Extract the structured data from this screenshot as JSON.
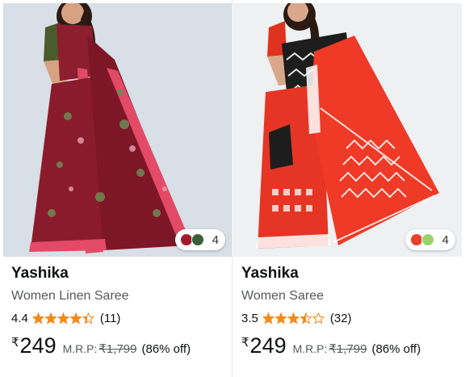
{
  "products": [
    {
      "brand": "Yashika",
      "title": "Women Linen Saree",
      "rating": 4.4,
      "rating_text": "4.4",
      "review_count": "(11)",
      "currency_symbol": "₹",
      "price": "249",
      "mrp_label": "M.R.P:",
      "mrp": "₹1,799",
      "discount": "(86% off)",
      "color_count": "4",
      "swatch_colors": [
        "#a21a2e",
        "#3a5f3a"
      ]
    },
    {
      "brand": "Yashika",
      "title": "Women Saree",
      "rating": 3.5,
      "rating_text": "3.5",
      "review_count": "(32)",
      "currency_symbol": "₹",
      "price": "249",
      "mrp_label": "M.R.P:",
      "mrp": "₹1,799",
      "discount": "(86% off)",
      "color_count": "4",
      "swatch_colors": [
        "#e8402a",
        "#9ad36a"
      ]
    }
  ],
  "colors": {
    "star": "#f08a1c",
    "brand_text": "#0f1111",
    "muted_text": "#565959"
  }
}
